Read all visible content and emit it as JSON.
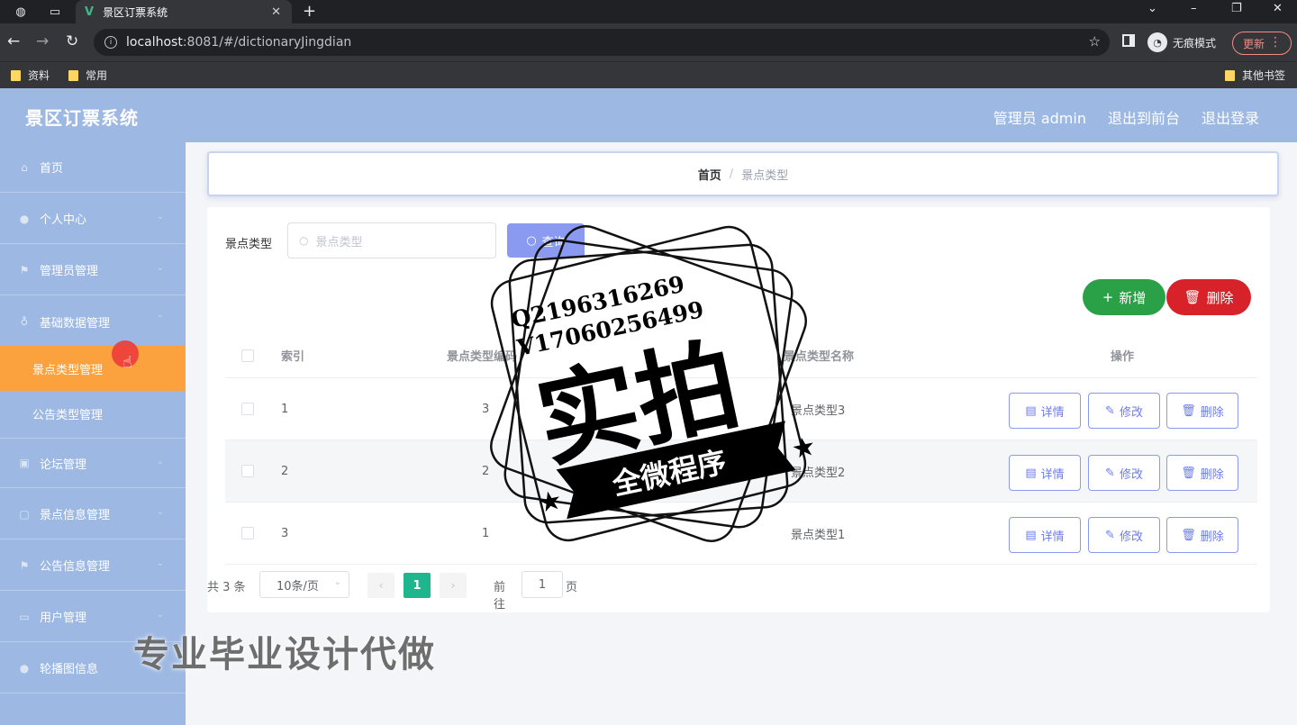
{
  "browser": {
    "tab_title": "景区订票系统",
    "tab_logo": "V",
    "url_host": "localhost",
    "url_rest": ":8081/#/dictionaryJingdian",
    "incognito_label": "无痕模式",
    "update_label": "更新",
    "bookmarks": [
      "资料",
      "常用"
    ],
    "other_bookmarks": "其他书签"
  },
  "app": {
    "title": "景区订票系统",
    "header_links": [
      "管理员 admin",
      "退出到前台",
      "退出登录"
    ]
  },
  "sidebar": {
    "items": [
      {
        "label": "首页",
        "icon": "home-icon"
      },
      {
        "label": "个人中心",
        "icon": "user-icon"
      },
      {
        "label": "管理员管理",
        "icon": "flag-icon"
      },
      {
        "label": "基础数据管理",
        "icon": "mic-icon"
      },
      {
        "label": "论坛管理",
        "icon": "picture-icon"
      },
      {
        "label": "景点信息管理",
        "icon": "document-icon"
      },
      {
        "label": "公告信息管理",
        "icon": "flag-icon"
      },
      {
        "label": "用户管理",
        "icon": "monitor-icon"
      },
      {
        "label": "轮播图信息",
        "icon": "user-icon"
      }
    ],
    "sub_items": [
      {
        "label": "景点类型管理",
        "active": true
      },
      {
        "label": "公告类型管理",
        "active": false
      }
    ]
  },
  "breadcrumb": {
    "home": "首页",
    "current": "景点类型"
  },
  "search": {
    "label": "景点类型",
    "placeholder": "景点类型",
    "button": "查询"
  },
  "actions": {
    "add": "新增",
    "delete": "删除"
  },
  "table": {
    "columns": [
      "索引",
      "景点类型编码",
      "景点类型名称",
      "操作"
    ],
    "rows": [
      {
        "index": "1",
        "code": "3",
        "name": "景点类型3"
      },
      {
        "index": "2",
        "code": "2",
        "name": "景点类型2"
      },
      {
        "index": "3",
        "code": "1",
        "name": "景点类型1"
      }
    ],
    "row_actions": [
      "详情",
      "修改",
      "删除"
    ]
  },
  "pagination": {
    "total": "共 3 条",
    "page_size": "10条/页",
    "current_page": "1",
    "goto_label": "前往",
    "goto_value": "1",
    "page_unit": "页"
  },
  "watermark": {
    "line1": "Q2196316269",
    "line2": "V17060256499",
    "big": "实拍",
    "banner": "全微程序",
    "bottom": "专业毕业设计代做"
  }
}
